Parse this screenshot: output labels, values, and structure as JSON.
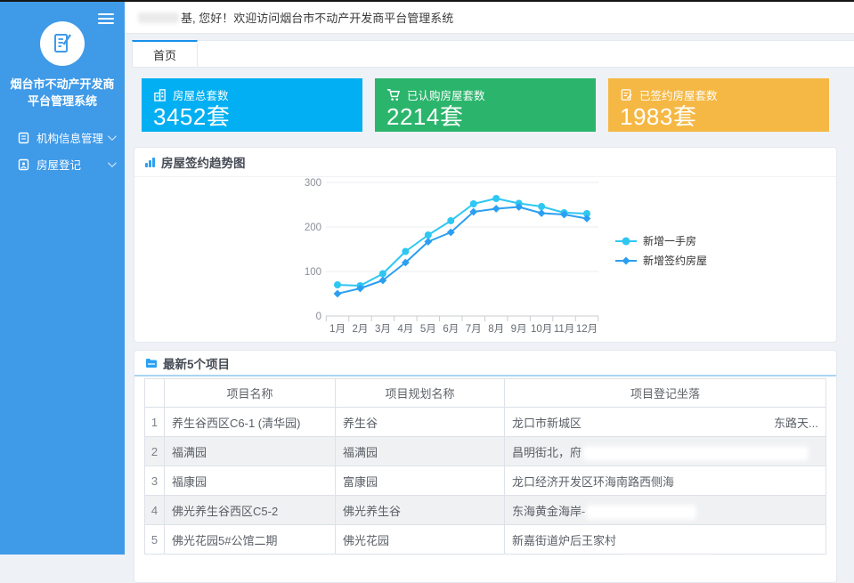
{
  "colors": {
    "sidebar": "#3f9ae8",
    "accent": "#1890e9",
    "card_blue": "#01aff2",
    "card_green": "#2bb56c",
    "card_yellow": "#f5b844",
    "series_cyan": "#2ec7f2",
    "series_blue": "#2b9ff1"
  },
  "header": {
    "greeting_suffix": "基, 您好！欢迎访问烟台市不动产开发商平台管理系统"
  },
  "sidebar": {
    "title": "烟台市不动产开发商平台管理系统",
    "items": [
      {
        "label": "机构信息管理",
        "icon": "org-info-icon"
      },
      {
        "label": "房屋登记",
        "icon": "house-register-icon"
      }
    ]
  },
  "tabs": [
    {
      "label": "首页",
      "active": true
    }
  ],
  "stats": [
    {
      "label": "房屋总套数",
      "value": "3452套",
      "color": "#01aff2",
      "icon": "building-icon"
    },
    {
      "label": "已认购房屋套数",
      "value": "2214套",
      "color": "#2bb56c",
      "icon": "cart-icon"
    },
    {
      "label": "已签约房屋套数",
      "value": "1983套",
      "color": "#f5b844",
      "icon": "contract-icon"
    }
  ],
  "chart_data": {
    "type": "line",
    "title": "房屋签约趋势图",
    "x": [
      "1月",
      "2月",
      "3月",
      "4月",
      "5月",
      "6月",
      "7月",
      "8月",
      "9月",
      "10月",
      "11月",
      "12月"
    ],
    "series": [
      {
        "name": "新增一手房",
        "color": "#2ec7f2",
        "marker": "circle",
        "values": [
          70,
          68,
          95,
          145,
          182,
          214,
          252,
          264,
          253,
          246,
          232,
          230
        ]
      },
      {
        "name": "新增签约房屋",
        "color": "#2b9ff1",
        "marker": "diamond",
        "values": [
          50,
          62,
          80,
          120,
          167,
          188,
          234,
          241,
          245,
          231,
          228,
          219
        ]
      }
    ],
    "ylim": [
      0,
      300
    ],
    "yticks": [
      0,
      100,
      200,
      300
    ],
    "grid": true,
    "legend_position": "right"
  },
  "projects": {
    "title": "最新5个项目",
    "columns": [
      "项目名称",
      "项目规划名称",
      "项目登记坐落"
    ],
    "rows": [
      {
        "no": "1",
        "name": "养生谷西区C6-1 (清华园)",
        "plan": "养生谷",
        "location_visible": "龙口市新城区",
        "location_tail": "东路天...",
        "redact_w": 210
      },
      {
        "no": "2",
        "name": "福满园",
        "plan": "福满园",
        "location_visible": "昌明街北，府",
        "location_tail": "",
        "redact_w": 250
      },
      {
        "no": "3",
        "name": "福康园",
        "plan": "富康园",
        "location_visible": "龙口经济开发区环海南路西侧海",
        "location_tail": "",
        "redact_w": 115
      },
      {
        "no": "4",
        "name": "佛光养生谷西区C5-2",
        "plan": "佛光养生谷",
        "location_visible": "东海黄金海岸-",
        "location_tail": "",
        "redact_w": 120
      },
      {
        "no": "5",
        "name": "佛光花园5#公馆二期",
        "plan": "佛光花园",
        "location_visible": "新嘉街道炉后王家村",
        "location_tail": "",
        "redact_w": 110
      }
    ]
  }
}
